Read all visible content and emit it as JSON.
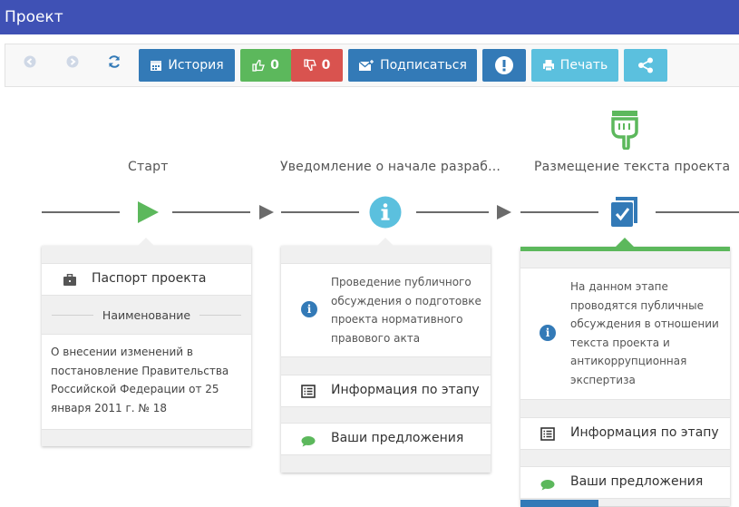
{
  "window": {
    "title": "Проект"
  },
  "toolbar": {
    "history_label": "История",
    "likes": "0",
    "dislikes": "0",
    "subscribe_label": "Подписаться",
    "print_label": "Печать"
  },
  "stages": [
    {
      "title": "Старт"
    },
    {
      "title": "Уведомление о начале разраб..."
    },
    {
      "title": "Размещение текста проекта"
    }
  ],
  "card_start": {
    "passport_label": "Паспорт проекта",
    "section_title": "Наименование",
    "name_text": "О внесении изменений в постановление Правительства Российской Федерации от 25 января 2011 г. № 18"
  },
  "card_notice": {
    "description": "Проведение публичного обсуждения о подготовке проекта нормативного правового акта",
    "info_label": "Информация по этапу",
    "proposals_label": "Ваши предложения"
  },
  "card_publish": {
    "description": "На данном этапе проводятся публичные обсуждения в отношении текста проекта и антикоррупционная экспертиза",
    "info_label": "Информация по этапу",
    "proposals_label": "Ваши предложения"
  },
  "colors": {
    "titlebar": "#3f51b5",
    "primary": "#337ab7",
    "success": "#5cb85c",
    "danger": "#d9534f",
    "info": "#5bc0de"
  }
}
